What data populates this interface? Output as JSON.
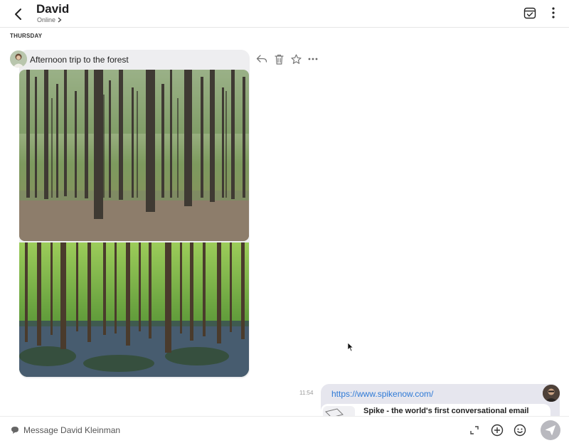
{
  "header": {
    "back_icon": "chevron-left-icon",
    "contact_name": "David",
    "status": "Online",
    "calendar_icon": "calendar-check-icon",
    "more_icon": "more-vertical-icon"
  },
  "thread": {
    "day_label": "THURSDAY",
    "incoming": {
      "text": "Afternoon trip to the forest",
      "photos": [
        "forest-photo",
        "bluebell-forest-photo"
      ],
      "actions": [
        "reply-icon",
        "trash-icon",
        "star-icon",
        "more-horizontal-icon"
      ]
    },
    "outgoing": {
      "time": "11:54",
      "link": "https://www.spikenow.com/",
      "preview_title": "Spike - the world's first conversational email"
    }
  },
  "composer": {
    "placeholder": "Message David Kleinman",
    "icons": [
      "expand-icon",
      "add-icon",
      "emoji-icon",
      "send-icon"
    ]
  },
  "colors": {
    "bubble_incoming": "#eeeef0",
    "bubble_outgoing": "#e6e6ee",
    "link": "#2f7ad6",
    "send_button": "#b9b9bf"
  }
}
